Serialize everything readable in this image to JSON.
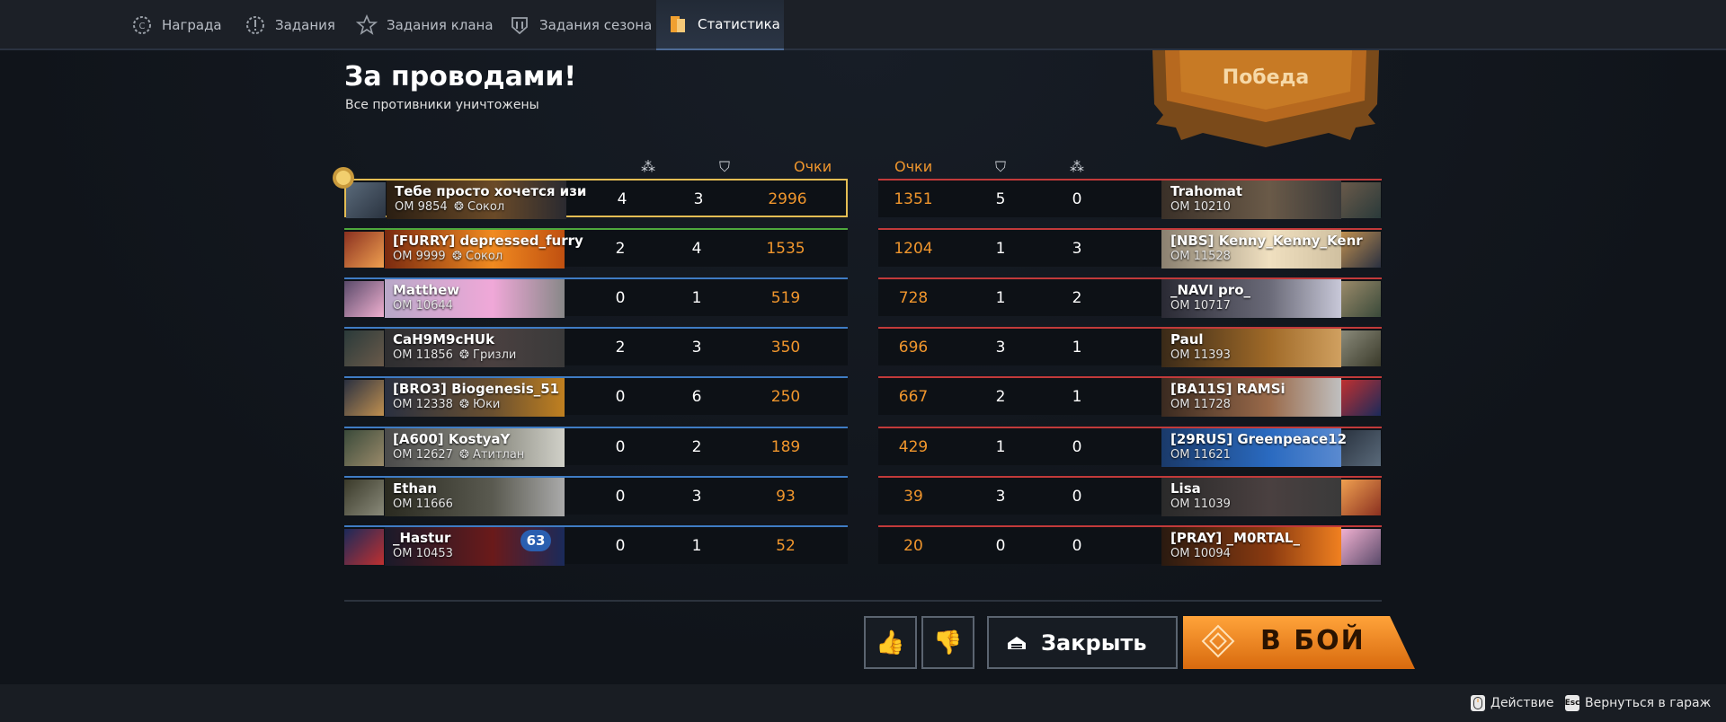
{
  "nav": {
    "tabs": [
      {
        "label": "Награда",
        "icon": "reward-icon"
      },
      {
        "label": "Задания",
        "icon": "tasks-icon"
      },
      {
        "label": "Задания клана",
        "icon": "clan-tasks-icon"
      },
      {
        "label": "Задания сезона",
        "icon": "season-tasks-icon"
      },
      {
        "label": "Статистика",
        "icon": "statistics-icon"
      }
    ],
    "active_tab": "Статистика"
  },
  "result": {
    "title": "За проводами!",
    "subtitle": "Все противники уничтожены",
    "banner": "Победа"
  },
  "columns": {
    "score_label": "Очки"
  },
  "left_team": [
    {
      "name": "Тебе просто хочется изи",
      "om": "ОМ 9854",
      "clan": "Сокол",
      "kills": "4",
      "deaths": "3",
      "score": "2996",
      "highlight": true
    },
    {
      "name": "[FURRY] depressed_furry",
      "om": "ОМ 9999",
      "clan": "Сокол",
      "kills": "2",
      "deaths": "4",
      "score": "1535"
    },
    {
      "name": "Matthew",
      "om": "ОМ 10644",
      "clan": "",
      "kills": "0",
      "deaths": "1",
      "score": "519"
    },
    {
      "name": "CaH9M9cHUk",
      "om": "ОМ 11856",
      "clan": "Гризли",
      "kills": "2",
      "deaths": "3",
      "score": "350"
    },
    {
      "name": "[BRO3] Biogenesis_51",
      "om": "ОМ 12338",
      "clan": "Юки",
      "kills": "0",
      "deaths": "6",
      "score": "250"
    },
    {
      "name": "[A600] KostyaY",
      "om": "ОМ 12627",
      "clan": "Атитлан",
      "kills": "0",
      "deaths": "2",
      "score": "189"
    },
    {
      "name": "Ethan",
      "om": "ОМ 11666",
      "clan": "",
      "kills": "0",
      "deaths": "3",
      "score": "93"
    },
    {
      "name": "_Hastur",
      "om": "ОМ 10453",
      "clan": "",
      "kills": "0",
      "deaths": "1",
      "score": "52",
      "badge": "63"
    }
  ],
  "right_team": [
    {
      "name": "Trahomat",
      "om": "ОМ 10210",
      "kills": "0",
      "deaths": "5",
      "score": "1351"
    },
    {
      "name": "[NBS] Kenny_Kenny_Kenr",
      "om": "ОМ 11528",
      "kills": "3",
      "deaths": "1",
      "score": "1204"
    },
    {
      "name": "_NAVI pro_",
      "om": "ОМ 10717",
      "kills": "2",
      "deaths": "1",
      "score": "728"
    },
    {
      "name": "Paul",
      "om": "ОМ 11393",
      "kills": "1",
      "deaths": "3",
      "score": "696"
    },
    {
      "name": "[BA11S] RAMSi",
      "om": "ОМ 11728",
      "kills": "1",
      "deaths": "2",
      "score": "667"
    },
    {
      "name": "[29RUS] Greenpeace12",
      "om": "ОМ 11621",
      "kills": "0",
      "deaths": "1",
      "score": "429"
    },
    {
      "name": "Lisa",
      "om": "ОМ 11039",
      "kills": "0",
      "deaths": "3",
      "score": "39"
    },
    {
      "name": "[PRAY] _M0RTAL_",
      "om": "ОМ 10094",
      "kills": "0",
      "deaths": "0",
      "score": "20"
    }
  ],
  "buttons": {
    "close": "Закрыть",
    "fight": "В БОЙ"
  },
  "footer": {
    "action": "Действие",
    "back": "Вернуться в гараж",
    "esc_key": "Esc"
  },
  "colors": {
    "accent_orange": "#f0962d",
    "ally_blue": "#3f7cc4",
    "enemy_red": "#c23a3a",
    "highlight_gold": "#e4bd53"
  }
}
